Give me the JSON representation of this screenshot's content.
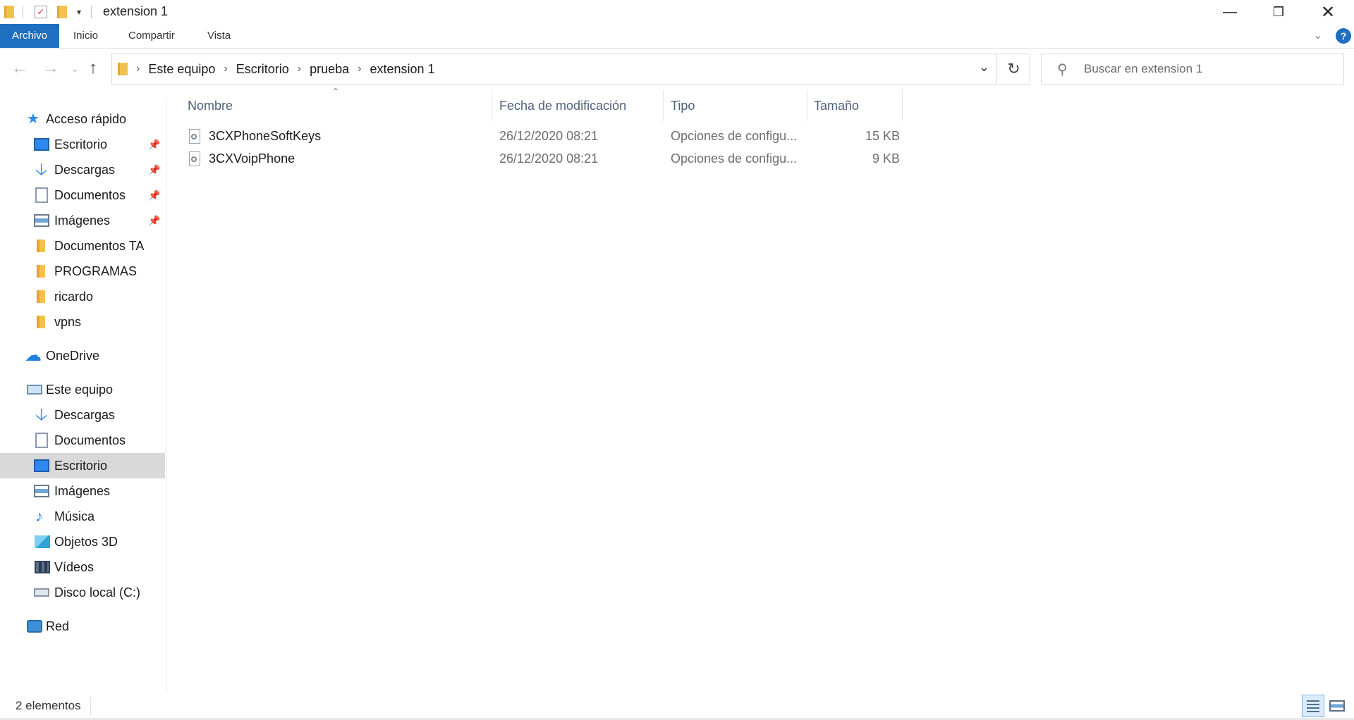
{
  "window": {
    "title": "extension 1",
    "minimize_icon": "minimize-icon",
    "maximize_icon": "restore-icon",
    "close_icon": "close-icon"
  },
  "ribbon": {
    "tabs": [
      "Archivo",
      "Inicio",
      "Compartir",
      "Vista"
    ]
  },
  "address": {
    "crumbs": [
      "Este equipo",
      "Escritorio",
      "prueba",
      "extension 1"
    ]
  },
  "search": {
    "placeholder": "Buscar en extension 1"
  },
  "sidebar": {
    "items": [
      {
        "label": "Acceso rápido",
        "icon": "star-icon"
      },
      {
        "label": "Escritorio",
        "icon": "desktop-icon",
        "pinned": true
      },
      {
        "label": "Descargas",
        "icon": "download-icon",
        "pinned": true
      },
      {
        "label": "Documentos",
        "icon": "document-icon",
        "pinned": true
      },
      {
        "label": "Imágenes",
        "icon": "image-icon",
        "pinned": true
      },
      {
        "label": "Documentos TA",
        "icon": "folder-icon"
      },
      {
        "label": "PROGRAMAS",
        "icon": "folder-icon"
      },
      {
        "label": "ricardo",
        "icon": "folder-icon"
      },
      {
        "label": "vpns",
        "icon": "folder-icon"
      },
      {
        "label": "OneDrive",
        "icon": "cloud-icon"
      },
      {
        "label": "Este equipo",
        "icon": "computer-icon"
      },
      {
        "label": "Descargas",
        "icon": "download-icon"
      },
      {
        "label": "Documentos",
        "icon": "document-icon"
      },
      {
        "label": "Escritorio",
        "icon": "desktop-icon",
        "selected": true
      },
      {
        "label": "Imágenes",
        "icon": "image-icon"
      },
      {
        "label": "Música",
        "icon": "music-icon"
      },
      {
        "label": "Objetos 3D",
        "icon": "cube-icon"
      },
      {
        "label": "Vídeos",
        "icon": "video-icon"
      },
      {
        "label": "Disco local (C:)",
        "icon": "drive-icon"
      },
      {
        "label": "Red",
        "icon": "network-icon"
      }
    ]
  },
  "columns": {
    "name": "Nombre",
    "modified": "Fecha de modificación",
    "type": "Tipo",
    "size": "Tamaño"
  },
  "files": [
    {
      "name": "3CXPhoneSoftKeys",
      "modified": "26/12/2020 08:21",
      "type": "Opciones de configu...",
      "size": "15 KB"
    },
    {
      "name": "3CXVoipPhone",
      "modified": "26/12/2020 08:21",
      "type": "Opciones de configu...",
      "size": "9 KB"
    }
  ],
  "status": {
    "count": "2 elementos"
  },
  "colors": {
    "accent": "#1e6fbf",
    "selected_bg": "#d9d9d9"
  }
}
